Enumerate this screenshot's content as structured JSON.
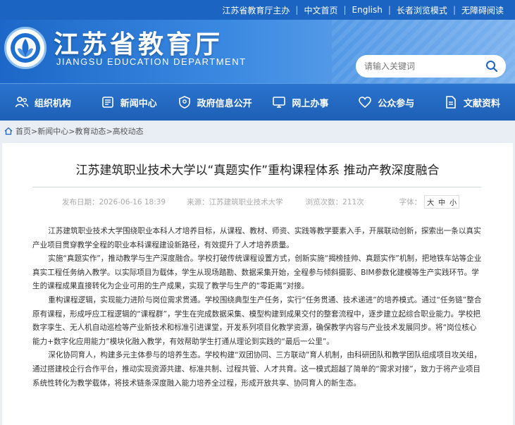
{
  "topbar": {
    "sponsor": "江苏省教育厅主办",
    "lang_cn": "中文首页",
    "lang_en": "English",
    "elder_mode": "长者浏览模式",
    "accessibility": "无障碍阅读"
  },
  "header": {
    "title": "江苏省教育厅",
    "subtitle": "JIANGSU EDUCATION DEPARTMENT",
    "search_placeholder": "请输入关键词"
  },
  "nav": {
    "items": [
      {
        "label": "组织机构",
        "icon": "people-icon"
      },
      {
        "label": "新闻中心",
        "icon": "news-icon"
      },
      {
        "label": "政府信息公开",
        "icon": "info-disclosure-icon"
      },
      {
        "label": "网上办事",
        "icon": "monitor-icon"
      },
      {
        "label": "公众参与",
        "icon": "heart-icon"
      },
      {
        "label": "文献资料",
        "icon": "document-icon"
      }
    ]
  },
  "breadcrumb": [
    "首页",
    "新闻中心",
    "教育动态",
    "高校动态"
  ],
  "article": {
    "title": "江苏建筑职业技术大学以“真题实作”重构课程体系 推动产教深度融合",
    "published": "发布日期：2026-06-16 18:39",
    "source": "来源：江苏建筑职业技术大学",
    "views": "浏览次数：211次",
    "font_size_label": "字体：",
    "font_large": "大",
    "font_medium": "中",
    "font_small": "小",
    "paragraphs": [
      "江苏建筑职业技术大学围绕职业本科人才培养目标，从课程、教材、师资、实践等教学要素入手，开展联动创新，探索出一条以真实产业项目贯穿教学全程的职业本科课程建设新路径，有效提升了人才培养质量。",
      "实施“真题实作”，推动教学与生产深度融合。学校打破传统课程设置方式，创新实施“揭榜挂帅、真题实作”机制，把地铁车站等企业真实工程任务纳入教学。以实际项目为载体，学生从现场踏勘、数据采集开始，全程参与倾斜摄影、BIM参数化建模等生产实践环节。学生的课程成果直接转化为企业可用的生产成果，实现了教学与生产的“零距离”对接。",
      "重构课程逻辑，实现能力进阶与岗位需求贯通。学校围绕典型生产任务，实行“任务贯通、技术递进”的培养模式。通过“任务链”整合原有课程，形成呼应工程逻辑的“课程群”，学生在完成数据采集、模型构建到成果交付的整套流程中，逐步建立起综合职业能力。学校把数字孪生、无人机自动巡检等产业新技术和标准引进课堂，开发系列项目化教学资源，确保教学内容与产业技术发展同步。将“岗位核心能力+数字化应用能力”模块化融入教学，有效帮助学生打通从理论到实践的“最后一公里”。",
      "深化协同育人，构建多元主体参与的培养生态。学校构建“双团协同、三方联动”育人机制，由科研团队和教学团队组成项目攻关组，通过搭建校企行合作平台，推动实现资源共建、标准共制、过程共管、人才共育。这一模式超越了简单的“需求对接”，致力于将产业项目系统性转化为教学载体，将技术链条深度融入能力培养全过程，形成开放共享、协同育人的新生态。"
    ]
  },
  "colors": {
    "brand_blue": "#1c64c2",
    "nav_blue": "#2369c2",
    "page_bg": "#e9eef5"
  }
}
